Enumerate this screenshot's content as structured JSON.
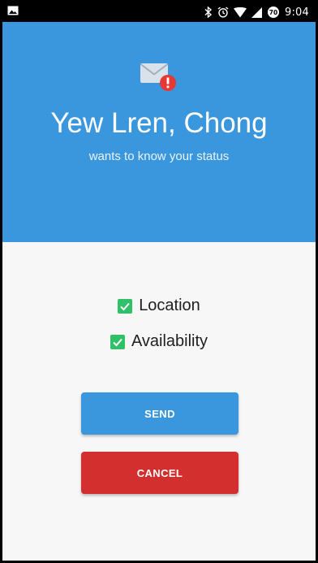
{
  "status_bar": {
    "time": "9:04",
    "notification_badge": "70",
    "icons": [
      "image-icon",
      "bluetooth-icon",
      "alarm-icon",
      "wifi-icon",
      "signal-icon"
    ]
  },
  "header": {
    "icon": "mail-alert-icon",
    "name": "Yew Lren, Chong",
    "subtitle": "wants to know your status"
  },
  "options": [
    {
      "label": "Location",
      "checked": true
    },
    {
      "label": "Availability",
      "checked": true
    }
  ],
  "actions": {
    "send_label": "SEND",
    "cancel_label": "CANCEL"
  },
  "colors": {
    "primary": "#3a96dd",
    "danger": "#d32f2f",
    "check": "#2fc068",
    "alert": "#e53935"
  }
}
